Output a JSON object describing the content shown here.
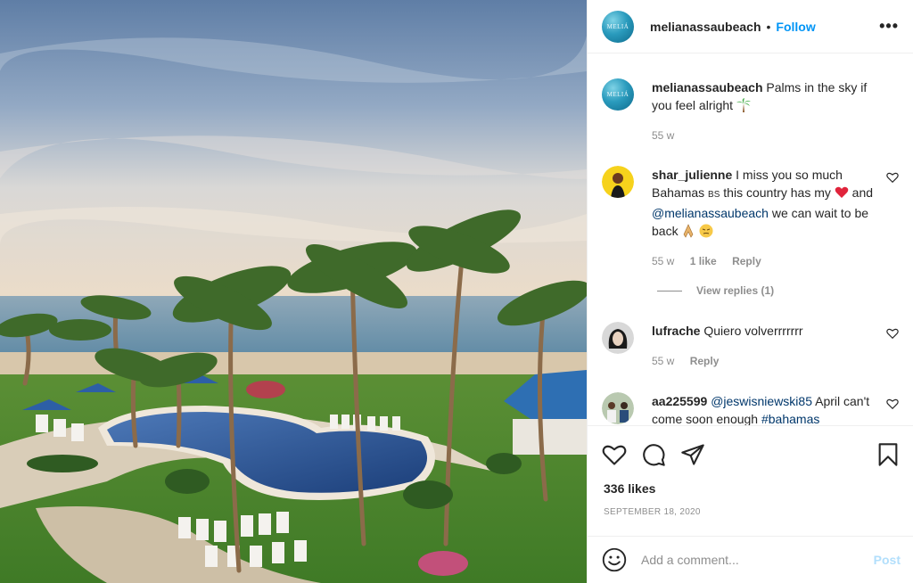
{
  "post": {
    "username": "melianassaubeach",
    "follow_label": "Follow",
    "dot": "•",
    "more_label": "•••",
    "brand_logo_text": "MELIÁ"
  },
  "caption": {
    "username": "melianassaubeach",
    "text": "Palms in the sky if you feel alright",
    "emoji": "palm-tree",
    "time": "55 w"
  },
  "comments": [
    {
      "username": "shar_julienne",
      "text_1": "I miss you so much Bahamas",
      "flag": "BS",
      "text_2": "this country has my",
      "text_3": "and",
      "mention": "@melianassaubeach",
      "text_4": "we can wait to be back",
      "time": "55 w",
      "likes": "1 like",
      "reply": "Reply",
      "view_replies": "View replies (1)"
    },
    {
      "username": "lufrache",
      "text": "Quiero volverrrrrrr",
      "time": "55 w",
      "reply": "Reply"
    },
    {
      "username": "aa225599",
      "mention": "@jeswisniewski85",
      "text": "April can't come soon enough",
      "hashtag": "#bahamas"
    }
  ],
  "likes": "336 likes",
  "date": "SEPTEMBER 18, 2020",
  "add_comment": {
    "placeholder": "Add a comment...",
    "post_label": "Post"
  },
  "colors": {
    "accent": "#0095f6",
    "mention": "#00376b",
    "muted": "#8e8e8e",
    "post_disabled": "#b2dffc",
    "heart_red": "#ed4956"
  },
  "icons": [
    "more-icon",
    "heart-icon",
    "comment-icon",
    "share-icon",
    "bookmark-icon",
    "smiley-icon"
  ]
}
